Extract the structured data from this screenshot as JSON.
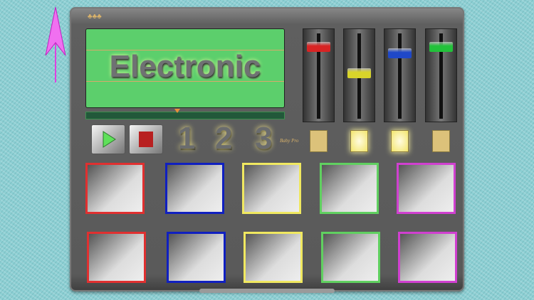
{
  "display": {
    "title": "Electronic"
  },
  "branding": {
    "logo_text": "Baby Pro"
  },
  "progress": {
    "position_percent": 46
  },
  "transport": {
    "play": "play",
    "stop": "stop"
  },
  "tracks": [
    "1",
    "2",
    "3"
  ],
  "faders": [
    {
      "color": "#d82424",
      "level": 0.9
    },
    {
      "color": "#d8d42a",
      "level": 0.55
    },
    {
      "color": "#1f48c8",
      "level": 0.82
    },
    {
      "color": "#22c23a",
      "level": 0.9
    }
  ],
  "lights": [
    false,
    true,
    true,
    false
  ],
  "pads": [
    [
      "#e03030",
      "#1020c0",
      "#f0e860",
      "#60d060",
      "#d040d0"
    ],
    [
      "#e03030",
      "#1020c0",
      "#f0e860",
      "#60d060",
      "#d040d0"
    ]
  ]
}
